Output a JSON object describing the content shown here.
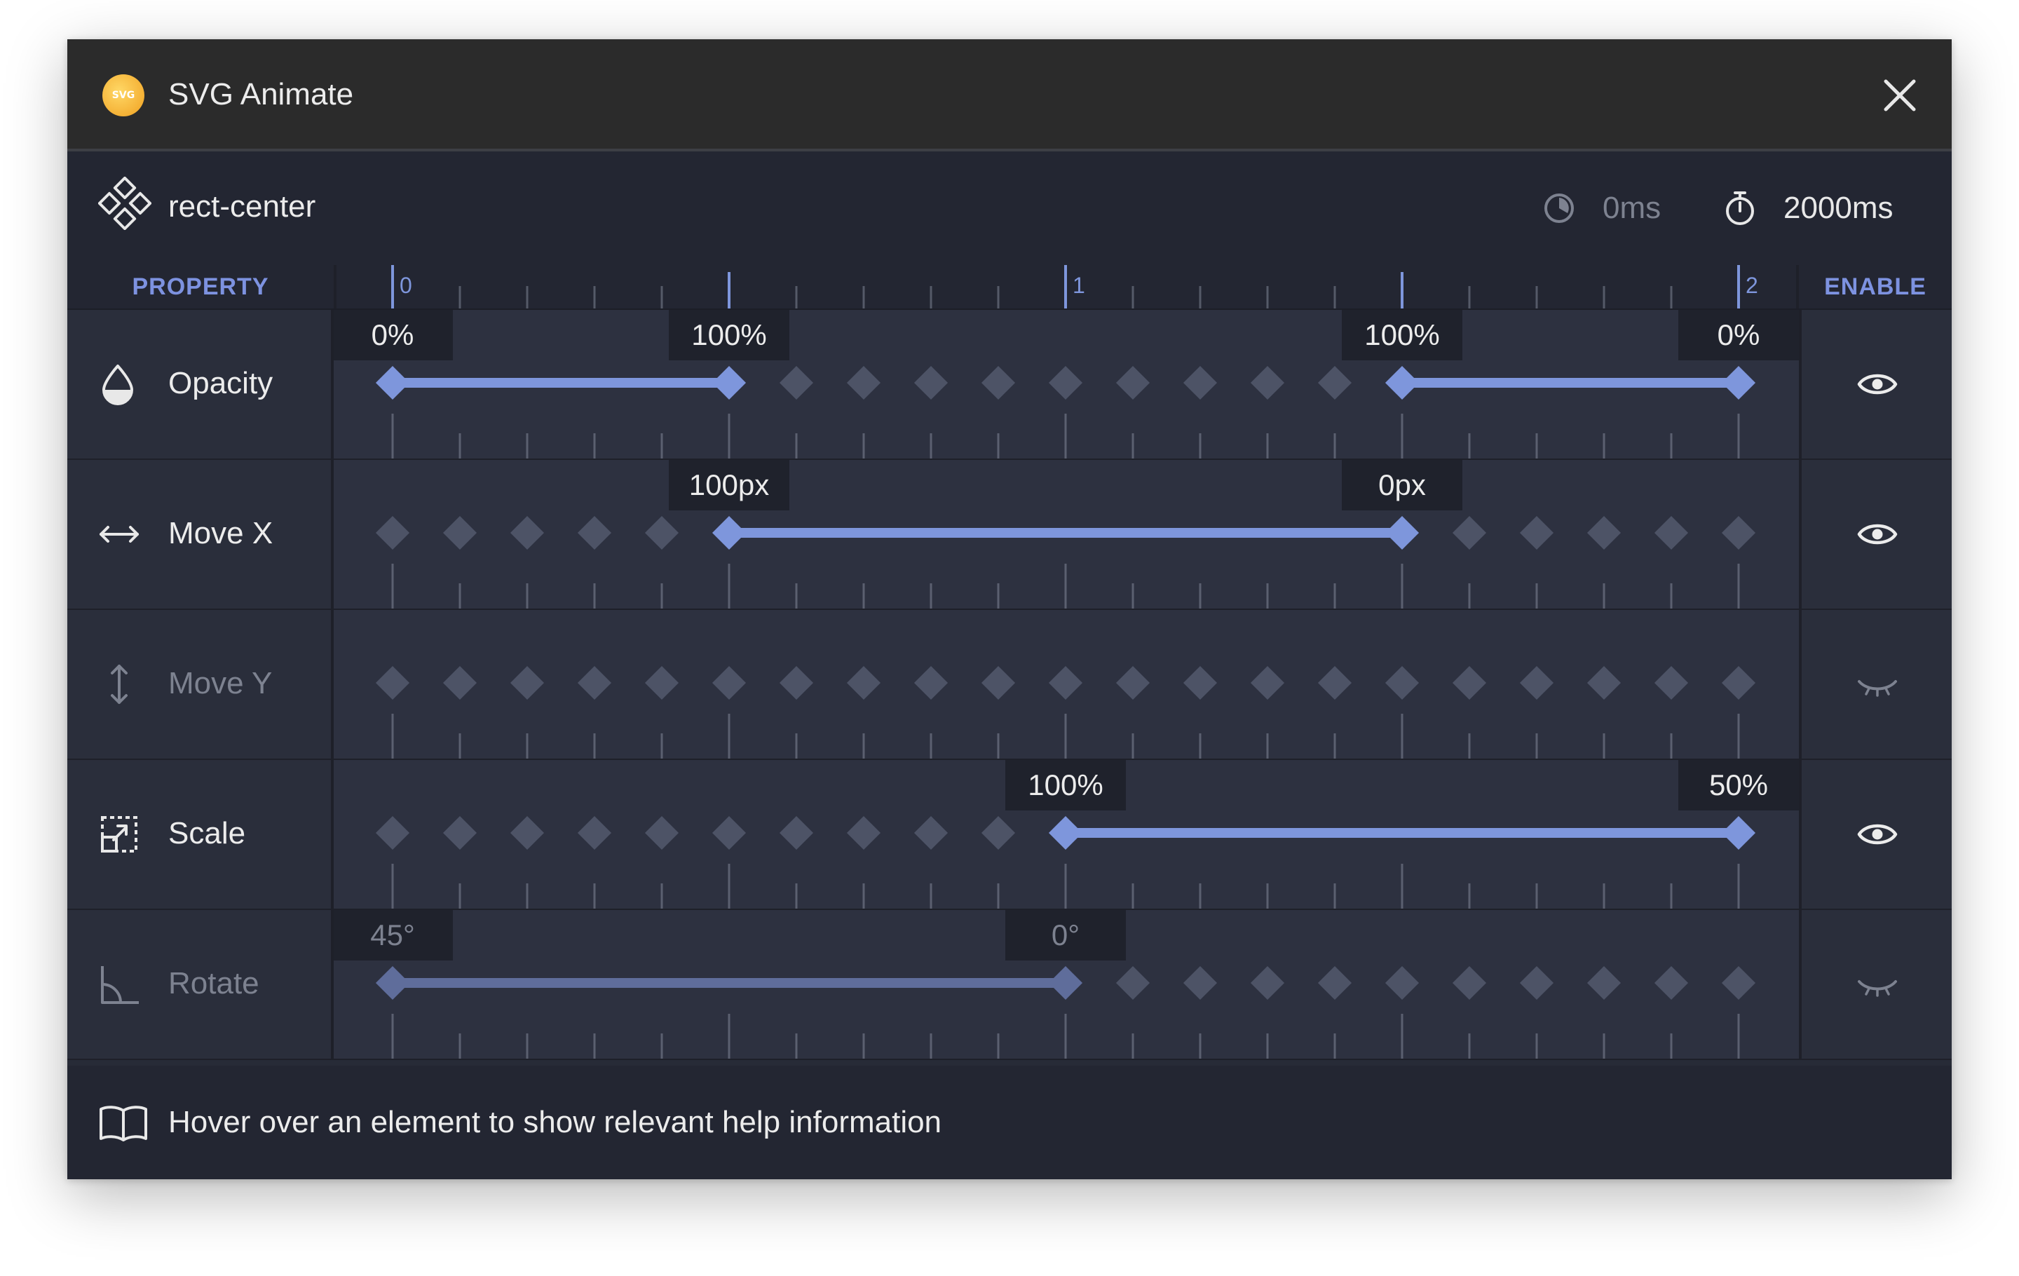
{
  "window": {
    "title": "SVG Animate",
    "logo_text": "SVG"
  },
  "element": {
    "name": "rect-center",
    "delay": "0ms",
    "duration": "2000ms"
  },
  "header": {
    "property_label": "PROPERTY",
    "enable_label": "ENABLE"
  },
  "ruler": {
    "labels": [
      "0",
      "1",
      "2"
    ]
  },
  "colors": {
    "accent": "#7e96dc",
    "accent_dim": "#5f6d9b",
    "diamond": "#4d5366",
    "panel": "#2d3140",
    "text": "#ececec",
    "text_dim": "#7d8290"
  },
  "properties": [
    {
      "label": "Opacity",
      "icon": "drop-icon",
      "enabled": true,
      "segments": [
        {
          "from": 0,
          "to": 5,
          "from_label": "0%",
          "to_label": "100%"
        },
        {
          "from": 15,
          "to": 20,
          "from_label": "100%",
          "to_label": "0%"
        }
      ]
    },
    {
      "label": "Move X",
      "icon": "arrows-horizontal-icon",
      "enabled": true,
      "segments": [
        {
          "from": 5,
          "to": 15,
          "from_label": "100px",
          "to_label": "0px"
        }
      ]
    },
    {
      "label": "Move Y",
      "icon": "arrows-vertical-icon",
      "enabled": false,
      "segments": []
    },
    {
      "label": "Scale",
      "icon": "scale-icon",
      "enabled": true,
      "segments": [
        {
          "from": 10,
          "to": 20,
          "from_label": "100%",
          "to_label": "50%"
        }
      ]
    },
    {
      "label": "Rotate",
      "icon": "rotate-icon",
      "enabled": false,
      "segments": [
        {
          "from": 0,
          "to": 10,
          "from_label": "45°",
          "to_label": "0°"
        }
      ]
    }
  ],
  "footer": {
    "help_text": "Hover over an element to show relevant help information"
  }
}
